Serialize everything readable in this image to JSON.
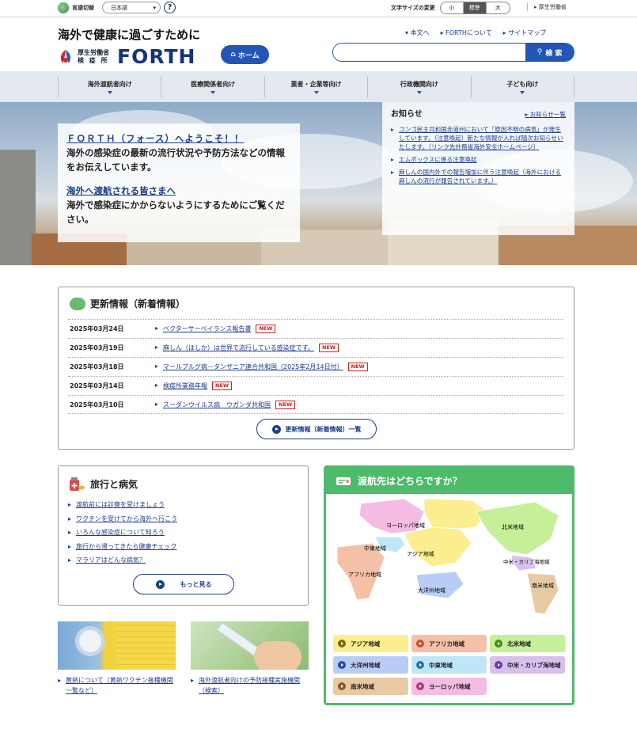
{
  "topbar": {
    "lang_label": "言語切替",
    "lang_value": "日本語",
    "help": "?",
    "fontsize_label": "文字サイズの変更",
    "fontsize_options": [
      "小",
      "標準",
      "大"
    ],
    "mhlw_link": "厚生労働省"
  },
  "header": {
    "tagline": "海外で健康に過ごすために",
    "org_line1": "厚生労働省",
    "org_line2": "検 疫 所",
    "logo": "FORTH",
    "home": "ホーム",
    "links": [
      "本文へ",
      "FORTHについて",
      "サイトマップ"
    ],
    "search_placeholder": "",
    "search_button": "検 索"
  },
  "gnav": [
    "海外渡航者向け",
    "医療関係者向け",
    "業者・企業等向け",
    "行政機関向け",
    "子ども向け"
  ],
  "hero": {
    "welcome_title": "ＦＯＲＴＨ（フォース）へようこそ！！",
    "welcome_text": "海外の感染症の最新の流行状況や予防方法などの情報をお伝えしています。",
    "travelers_title": "海外へ渡航される皆さまへ",
    "travelers_text": "海外で感染症にかからないようにするためにご覧ください。"
  },
  "news": {
    "title": "お知らせ",
    "list_link": "お知らせ一覧",
    "items": [
      "コンゴ民主共和国赤道州において「原因不明の病気」が発生しています。（注意喚起）新たな情報が入れば随次お知らせいたします。（リンク先外務省海外安全ホームページ）",
      "エムポックスに係る注意喚起",
      "麻しんの国内外での報告増加に伴う注意喚起（海外における麻しんの流行が報告されています。）"
    ]
  },
  "updates": {
    "title": "更新情報（新着情報）",
    "new_badge": "NEW",
    "rows": [
      {
        "date": "2025年03月24日",
        "title": "ベクターサーベイランス報告書"
      },
      {
        "date": "2025年03月19日",
        "title": "麻しん（はしか）は世界で流行している感染症です。"
      },
      {
        "date": "2025年03月18日",
        "title": "マールブルグ病－タンザニア連合共和国（2025年2月14日付）"
      },
      {
        "date": "2025年03月14日",
        "title": "検疫所業務年報"
      },
      {
        "date": "2025年03月10日",
        "title": "スーダンウイルス病　ウガンダ共和国"
      }
    ],
    "more": "更新情報（新着情報）一覧"
  },
  "travel": {
    "title": "旅行と病気",
    "items": [
      "渡航前には診察を受けましょう",
      "ワクチンを受けてから海外へ行こう",
      "いろんな感染症について知ろう",
      "旅行から帰ってきたら健康チェック",
      "マラリアはどんな病気？"
    ],
    "more": "もっと見る"
  },
  "photos": {
    "link1": "黄熱について（黄熱ワクチン接種機関一覧など）",
    "link2": "海外渡航者向けの予防接種実施機関（検索）"
  },
  "destination": {
    "title": "渡航先はどちらですか？",
    "map_labels": [
      "ヨーロッパ地域",
      "北米地域",
      "中東地域",
      "アジア地域",
      "アフリカ地域",
      "中米・カリブ海地域",
      "南米地域",
      "大洋州地域"
    ],
    "regions": [
      {
        "label": "アジア地域",
        "bg": "#fbee8f",
        "dot": "#7d6a16"
      },
      {
        "label": "アフリカ地域",
        "bg": "#f5c0a8",
        "dot": "#c2542e"
      },
      {
        "label": "北米地域",
        "bg": "#c5ef98",
        "dot": "#4c8a1f"
      },
      {
        "label": "大洋州地域",
        "bg": "#b8cdf6",
        "dot": "#2c4d99"
      },
      {
        "label": "中東地域",
        "bg": "#bfe6f7",
        "dot": "#1f7aa3"
      },
      {
        "label": "中米・カリブ海地域",
        "bg": "#d7c0ee",
        "dot": "#6e3aa3"
      },
      {
        "label": "南米地域",
        "bg": "#e9c9a4",
        "dot": "#8a5a26"
      },
      {
        "label": "ヨーロッパ地域",
        "bg": "#f4bce3",
        "dot": "#b2377f"
      }
    ]
  }
}
